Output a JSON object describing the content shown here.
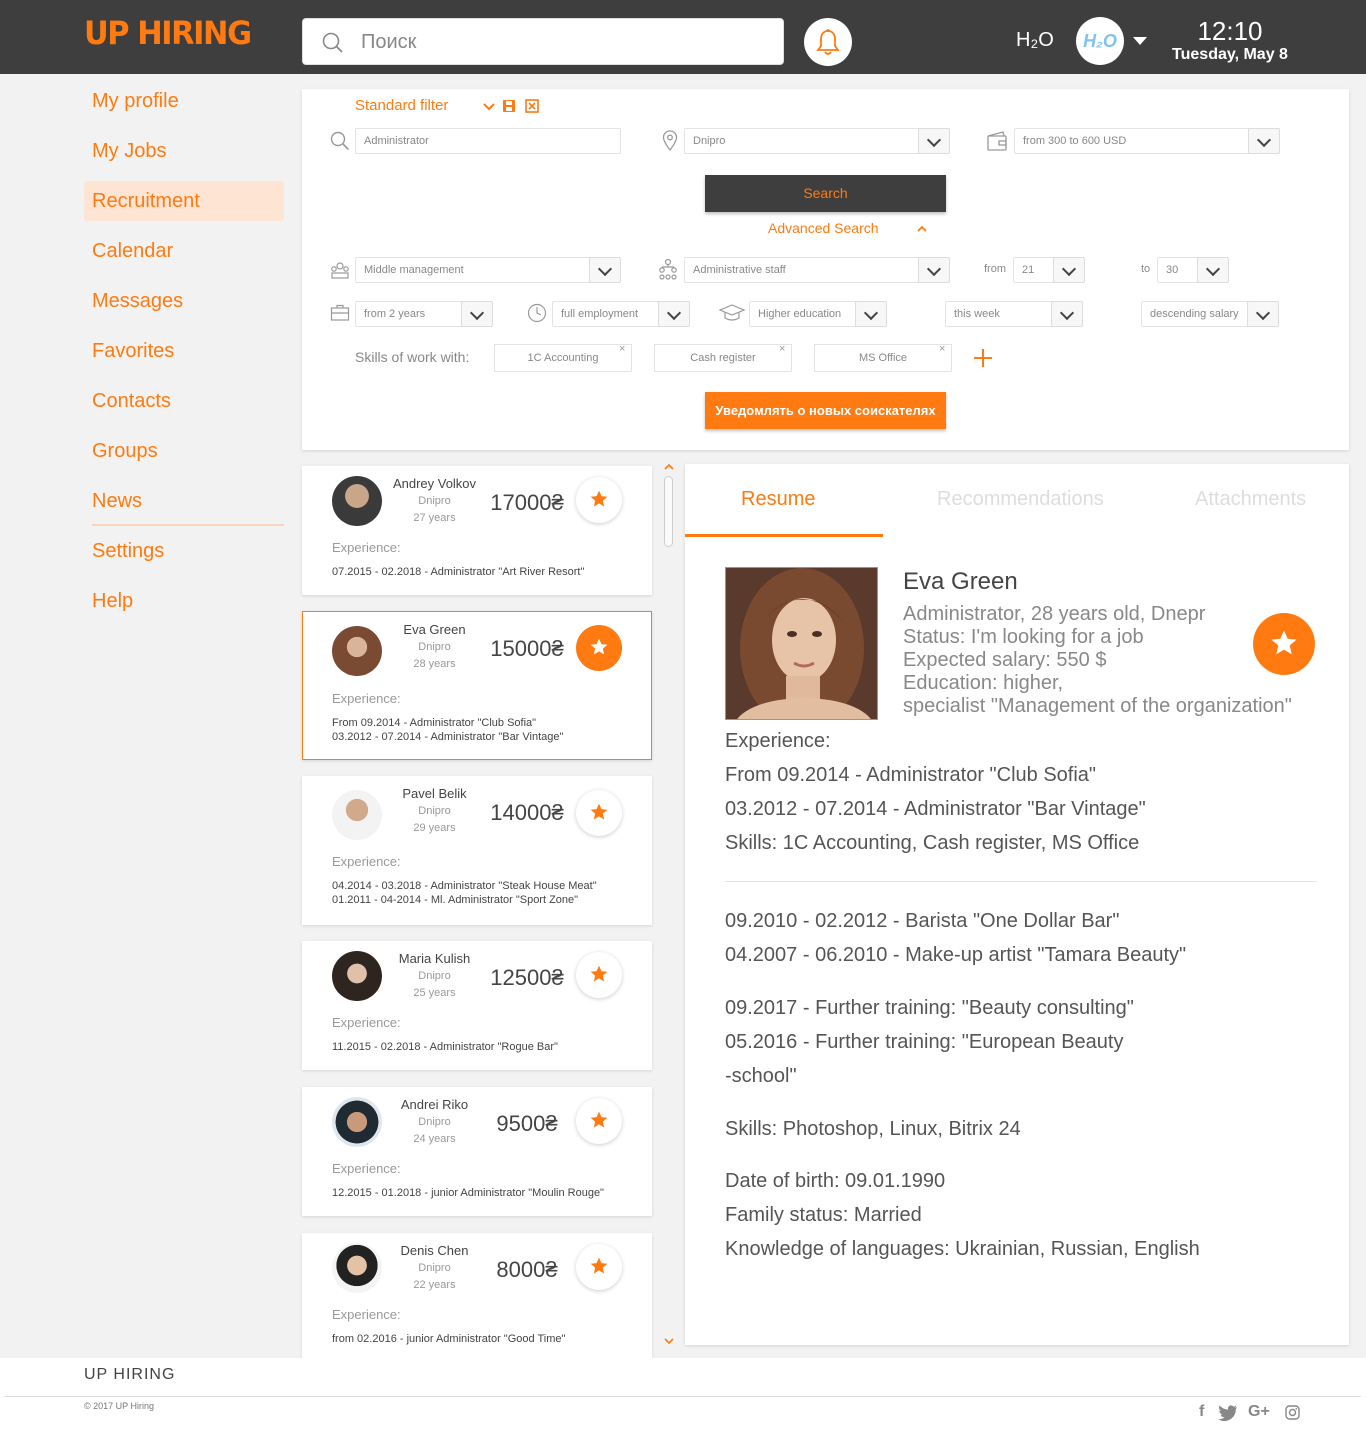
{
  "header": {
    "logo": "UP HIRING",
    "search_placeholder": "Поиск",
    "company": "H₂O",
    "avatar_text": "H₂O",
    "time": "12:10",
    "date": "Tuesday, May 8"
  },
  "sidebar": {
    "items": [
      {
        "label": "My profile"
      },
      {
        "label": "My Jobs"
      },
      {
        "label": "Recruitment",
        "active": true
      },
      {
        "label": "Calendar"
      },
      {
        "label": "Messages"
      },
      {
        "label": "Favorites"
      },
      {
        "label": "Contacts"
      },
      {
        "label": "Groups"
      },
      {
        "label": "News"
      },
      {
        "label": "Settings"
      },
      {
        "label": "Help"
      }
    ]
  },
  "filter": {
    "title": "Standard filter",
    "position": "Administrator",
    "city": "Dnipro",
    "salary": "from 300 to 600 USD",
    "search_label": "Search",
    "advanced_label": "Advanced Search",
    "level": "Middle management",
    "category": "Administrative staff",
    "age_from_label": "from",
    "age_from": "21",
    "age_to_label": "to",
    "age_to": "30",
    "experience": "from 2 years",
    "employment": "full employment",
    "education": "Higher education",
    "period": "this week",
    "sort": "descending salary",
    "skills_label": "Skills of work with:",
    "skills": [
      "1C Accounting",
      "Cash register",
      "MS Office"
    ],
    "notify_label": "Уведомлять о новых соискателях"
  },
  "candidates": [
    {
      "name": "Andrey Volkov",
      "city": "Dnipro",
      "age": "27 years",
      "salary": "17000₴",
      "favorite": false,
      "exp_label": "Experience:",
      "exp": [
        "07.2015 - 02.2018 - Administrator \"Art River Resort\""
      ]
    },
    {
      "name": "Eva Green",
      "city": "Dnipro",
      "age": "28 years",
      "salary": "15000₴",
      "favorite": true,
      "exp_label": "Experience:",
      "exp": [
        "From 09.2014 - Administrator \"Club Sofia\"",
        "03.2012 - 07.2014 - Administrator \"Bar Vintage\""
      ]
    },
    {
      "name": "Pavel Belik",
      "city": "Dnipro",
      "age": "29 years",
      "salary": "14000₴",
      "favorite": false,
      "exp_label": "Experience:",
      "exp": [
        "04.2014 - 03.2018 - Administrator \"Steak House Meat\"",
        "01.2011 - 04-2014 - Ml. Administrator \"Sport Zone\""
      ]
    },
    {
      "name": "Maria Kulish",
      "city": "Dnipro",
      "age": "25 years",
      "salary": "12500₴",
      "favorite": false,
      "exp_label": "Experience:",
      "exp": [
        "11.2015 - 02.2018 - Administrator \"Rogue Bar\""
      ]
    },
    {
      "name": "Andrei Riko",
      "city": "Dnipro",
      "age": "24 years",
      "salary": "9500₴",
      "favorite": false,
      "exp_label": "Experience:",
      "exp": [
        "12.2015 - 01.2018 - junior Administrator \"Moulin Rouge\""
      ]
    },
    {
      "name": "Denis Chen",
      "city": "Dnipro",
      "age": "22 years",
      "salary": "8000₴",
      "favorite": false,
      "exp_label": "Experience:",
      "exp": [
        "from 02.2016 - junior Administrator \"Good Time\""
      ]
    }
  ],
  "resume": {
    "tabs": [
      "Resume",
      "Recommendations",
      "Attachments"
    ],
    "name": "Eva Green",
    "info": [
      "Administrator, 28 years old, Dnepr",
      "Status: I'm looking for a job",
      "Expected salary: 550 $",
      "Education: higher,",
      "specialist \"Management of the organization\""
    ],
    "exp_label": "Experience:",
    "exp": [
      "From 09.2014 - Administrator \"Club Sofia\"",
      "03.2012 - 07.2014 - Administrator \"Bar Vintage\"",
      "Skills: 1C Accounting, Cash register, MS Office"
    ],
    "more": [
      "09.2010 - 02.2012 - Barista \"One Dollar Bar\"",
      "04.2007 - 06.2010 - Make-up artist \"Tamara Beauty\"",
      "09.2017 - Further training: \"Beauty consulting\"",
      "05.2016 - Further training: \"European Beauty",
      "-school\"",
      "Skills: Photoshop, Linux, Bitrix 24",
      "Date of birth: 09.01.1990",
      "Family status: Married",
      "Knowledge of languages: Ukrainian, Russian, English"
    ]
  },
  "footer": {
    "brand": "UP HIRING",
    "copyright": "© 2017 UP Hiring",
    "social": [
      "f",
      "G+"
    ]
  },
  "colors": {
    "accent": "#ff7a10",
    "header_bg": "#3e3e3e",
    "active_nav_bg": "#fde4d3"
  }
}
